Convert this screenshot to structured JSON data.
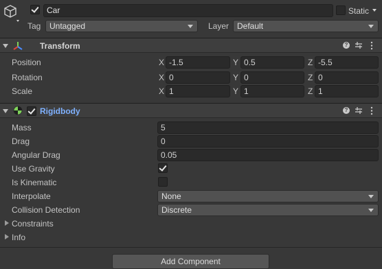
{
  "gameobject": {
    "active": true,
    "name": "Car",
    "static_label": "Static",
    "static_checked": false,
    "tag_label": "Tag",
    "tag_value": "Untagged",
    "layer_label": "Layer",
    "layer_value": "Default"
  },
  "transform": {
    "title": "Transform",
    "rows": [
      {
        "label": "Position",
        "x": "-1.5",
        "y": "0.5",
        "z": "-5.5"
      },
      {
        "label": "Rotation",
        "x": "0",
        "y": "0",
        "z": "0"
      },
      {
        "label": "Scale",
        "x": "1",
        "y": "1",
        "z": "1"
      }
    ],
    "axis": {
      "x": "X",
      "y": "Y",
      "z": "Z"
    }
  },
  "rigidbody": {
    "title": "Rigidbody",
    "mass_label": "Mass",
    "mass": "5",
    "drag_label": "Drag",
    "drag": "0",
    "angular_drag_label": "Angular Drag",
    "angular_drag": "0.05",
    "use_gravity_label": "Use Gravity",
    "use_gravity": true,
    "is_kinematic_label": "Is Kinematic",
    "is_kinematic": false,
    "interpolate_label": "Interpolate",
    "interpolate": "None",
    "collision_label": "Collision Detection",
    "collision": "Discrete",
    "constraints_label": "Constraints",
    "info_label": "Info"
  },
  "add_component_label": "Add Component",
  "colors": {
    "background": "#383838",
    "field": "#2a2a2a",
    "rigidbody_title": "#7fb1ff",
    "transform_red": "#e0453c",
    "transform_green": "#7ed15a",
    "transform_blue": "#4a8bff"
  }
}
